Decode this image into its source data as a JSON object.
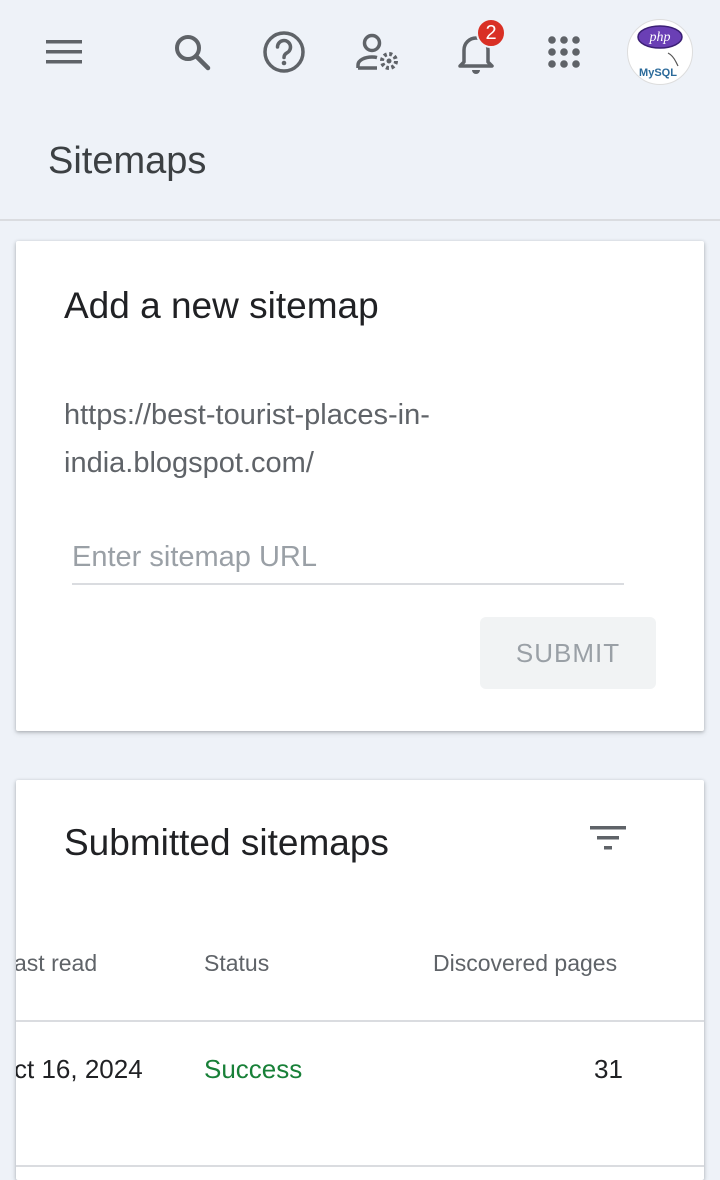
{
  "header": {
    "notification_count": "2",
    "icons": [
      "menu-icon",
      "search-icon",
      "help-icon",
      "manage-users-icon",
      "notifications-icon",
      "apps-icon"
    ],
    "avatar_text_top": "php",
    "avatar_text_bottom": "MySQL"
  },
  "page": {
    "title": "Sitemaps"
  },
  "add_sitemap": {
    "title": "Add a new sitemap",
    "property_url": "https://best-tourist-places-in-india.blogspot.com/",
    "input_placeholder": "Enter sitemap URL",
    "input_value": "",
    "submit_label": "SUBMIT"
  },
  "submitted": {
    "title": "Submitted sitemaps",
    "columns": [
      "ast read",
      "Status",
      "Discovered pages"
    ],
    "rows": [
      {
        "last_read": "ct 16, 2024",
        "status": "Success",
        "discovered_pages": "31"
      }
    ],
    "success_color": "#188038"
  }
}
